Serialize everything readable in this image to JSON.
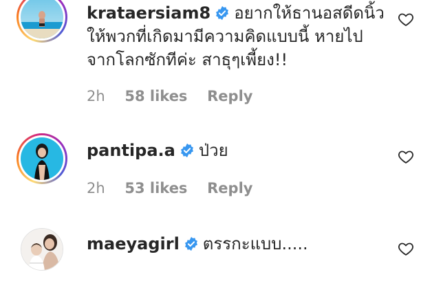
{
  "comments": [
    {
      "username": "krataersiam8",
      "text": "อยากให้ธานอสดีดนิ้วให้พวกที่เกิดมามีความคิดแบบนี้ หายไปจากโลกซักทีค่ะ สาธุๆเพี้ยง!!",
      "time": "2h",
      "likes": "58 likes",
      "reply": "Reply",
      "avatar": "beach-photo",
      "verified": true
    },
    {
      "username": "pantipa.a",
      "text": "ป่วย",
      "time": "2h",
      "likes": "53 likes",
      "reply": "Reply",
      "avatar": "woman-photo",
      "verified": true
    },
    {
      "username": "maeyagirl",
      "text": "ตรรกะแบบ.....",
      "time": "",
      "likes": "",
      "reply": "",
      "avatar": "mother-child-photo",
      "verified": true
    }
  ],
  "icons": {
    "verified": "verified-badge-icon",
    "like": "heart-outline-icon"
  },
  "colors": {
    "verified": "#3897f0",
    "meta": "#8e8e8e",
    "text": "#262626"
  }
}
